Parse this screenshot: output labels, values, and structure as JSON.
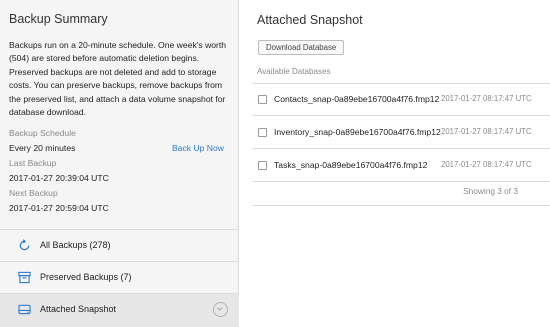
{
  "summary": {
    "title": "Backup Summary",
    "description": "Backups run on a 20-minute schedule. One week's worth (504) are stored before automatic deletion begins. Preserved backups are not deleted and add to storage costs. You can preserve backups, remove backups from the preserved list, and attach a data volume snapshot for database download.",
    "schedule_label": "Backup Schedule",
    "schedule_value": "Every 20 minutes",
    "backup_now_label": "Back Up Now",
    "last_label": "Last Backup",
    "last_value": "2017-01-27 20:39:04 UTC",
    "next_label": "Next Backup",
    "next_value": "2017-01-27 20:59:04 UTC"
  },
  "nav": {
    "items": [
      {
        "label": "All Backups (278)",
        "icon": "refresh-icon"
      },
      {
        "label": "Preserved Backups (7)",
        "icon": "archive-box-icon"
      },
      {
        "label": "Attached Snapshot",
        "icon": "disk-drive-icon",
        "active": true
      }
    ]
  },
  "snapshot": {
    "title": "Attached Snapshot",
    "download_label": "Download Database",
    "available_label": "Available Databases",
    "databases": [
      {
        "name": "Contacts_snap-0a89ebe16700a4f76.fmp12",
        "date": "2017-01-27 08:17:47 UTC"
      },
      {
        "name": "Inventory_snap-0a89ebe16700a4f76.fmp12",
        "date": "2017-01-27 08:17:47 UTC"
      },
      {
        "name": "Tasks_snap-0a89ebe16700a4f76.fmp12",
        "date": "2017-01-27 08:17:47 UTC"
      }
    ],
    "showing_text": "Showing 3 of 3"
  },
  "colors": {
    "link": "#2a7ad8",
    "icon": "#2a7ad8",
    "sidebar_bg": "#f5f5f5",
    "active_bg": "#e7e7e7"
  }
}
